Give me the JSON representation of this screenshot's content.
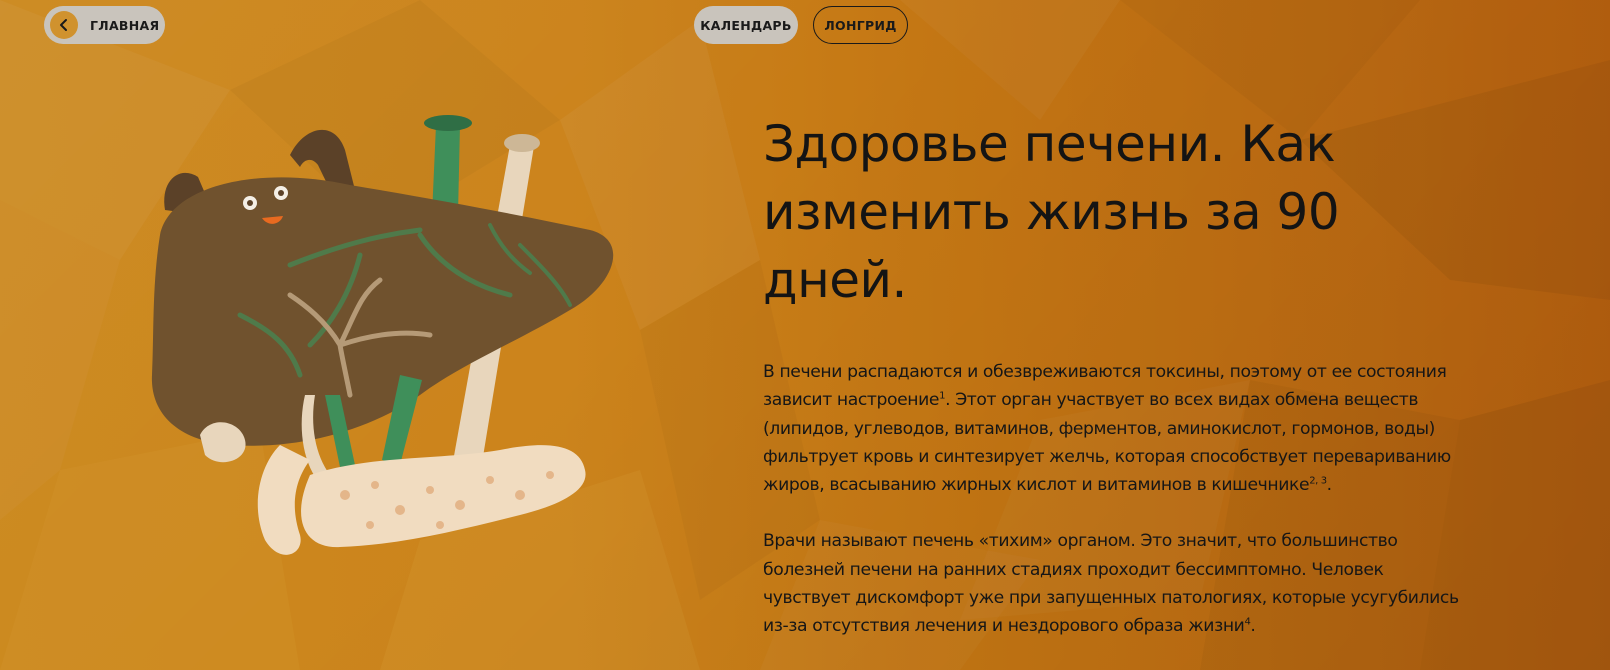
{
  "nav": {
    "home_label": "ГЛАВНАЯ",
    "calendar_label": "КАЛЕНДАРЬ",
    "longread_label": "ЛОНГРИД"
  },
  "article": {
    "title": "Здоровье печени. Как изменить жизнь за 90 дней.",
    "paragraphs": [
      {
        "parts": [
          "В печени распадаются и обезвреживаются токсины, поэтому от ее состояния зависит настроение",
          "1",
          ". Этот орган участвует во всех видах обмена веществ (липидов, углеводов, витаминов, ферментов, аминокислот, гормонов, воды) фильтрует кровь и синтезирует желчь, которая способствует перевариванию жиров, всасыванию жирных кислот и витаминов в кишечнике",
          "2, 3",
          "."
        ]
      },
      {
        "parts": [
          "Врачи называют печень «тихим» органом. Это значит, что большинство болезней печени на ранних стадиях проходит бессимптомно. Человек чувствует дискомфорт уже при запущенных патологиях, которые усугубились из-за отсутствия лечения и нездорового образа жизни",
          "4",
          "."
        ]
      }
    ]
  },
  "icons": {
    "back": "chevron-left-icon",
    "illustration": "liver-character-illustration"
  },
  "colors": {
    "background_start": "#e39a22",
    "background_end": "#c96b12",
    "pill_fill": "#c9c4bc",
    "back_circle": "#d0922e",
    "text": "#141414",
    "liver": "#7a5a32",
    "vessel_green": "#3f8f5a",
    "pancreas": "#f1dcc0"
  }
}
